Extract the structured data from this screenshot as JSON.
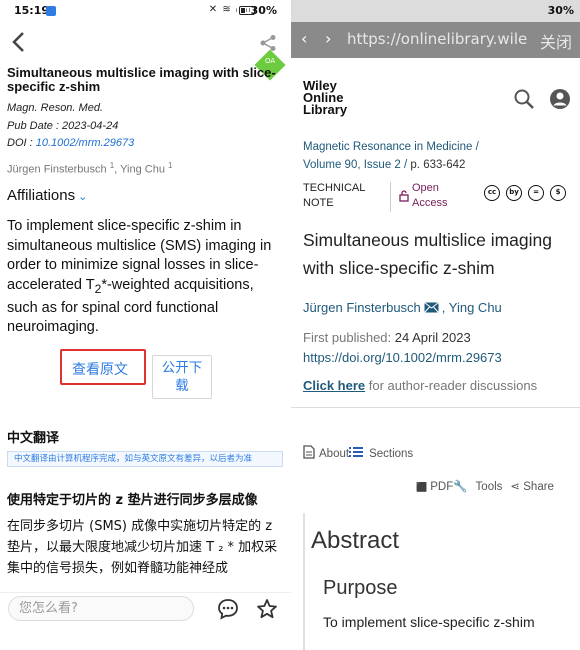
{
  "left": {
    "status": {
      "time": "15:19",
      "battery": "30%",
      "indicators": "✕ ≋ ᵢₗ ᵢₗ"
    },
    "oa_badge": "OA",
    "title": "Simultaneous multislice imaging with slice-specific z-shim",
    "journal": "Magn. Reson. Med.",
    "pub_date_label": "Pub Date",
    "pub_date": "2023-04-24",
    "doi_label": "DOI :",
    "doi": "10.1002/mrm.29673",
    "authors": [
      {
        "name": "Jürgen Finsterbusch",
        "sup": "1"
      },
      {
        "name": "Ying Chu",
        "sup": "1"
      }
    ],
    "affiliations": "Affiliations",
    "abstract": {
      "before_sub": "To implement slice-specific z-shim in simultaneous multislice (SMS) imaging in order to minimize signal losses in slice-accelerated T",
      "sub": "2",
      "after_sub": "*-weighted acquisitions, such as for spinal cord functional neuroimaging."
    },
    "view_original_btn": "查看原文",
    "public_download_btn_l1": "公开下",
    "public_download_btn_l2": "载",
    "cn_section_title": "中文翻译",
    "cn_note": "中文翻译由计算机程序完成，如与英文原文有差异，以后者为准",
    "cn_title": "使用特定于切片的 z 垫片进行同步多层成像",
    "cn_body": "在同步多切片 (SMS) 成像中实施切片特定的 z 垫片，以最大限度地减少切片加速 T ₂ * 加权采集中的信号损失，例如脊髓功能神经成",
    "comment_placeholder": "您怎么看?"
  },
  "right": {
    "url": "https://onlinelibrary.wiley.com",
    "close_label": "关闭",
    "logo_lines": [
      "Wiley",
      "Online",
      "Library"
    ],
    "journal_name": "Magnetic Resonance in Medicine /",
    "volume_issue": "Volume 90, Issue 2 /",
    "pages": "p. 633-642",
    "article_type_l1": "TECHNICAL",
    "article_type_l2": "NOTE",
    "open_access_l1": "Open",
    "open_access_l2": "Access",
    "cc_icons": [
      "cc",
      "by",
      "=",
      "$"
    ],
    "title": "Simultaneous multislice imaging with slice-specific z-shim",
    "author1": "Jürgen Finsterbusch",
    "author2": "Ying Chu",
    "first_published_label": "First published:",
    "first_published": "24 April 2023",
    "doi_url": "https://doi.org/10.1002/mrm.29673",
    "click_here": "Click here",
    "click_here_rest": " for author-reader discussions",
    "about": "About",
    "sections": "Sections",
    "pdf": "PDF",
    "tools": "Tools",
    "share": "Share",
    "abstract_heading": "Abstract",
    "purpose_heading": "Purpose",
    "abstract_start": "To implement slice-specific z-shim"
  },
  "colors": {
    "link_blue": "#2f7de1",
    "wiley_teal": "#1f5a7a",
    "oa_purple": "#7a1e5a",
    "highlight_red": "#e03030",
    "oa_green": "#6ccb3f"
  }
}
